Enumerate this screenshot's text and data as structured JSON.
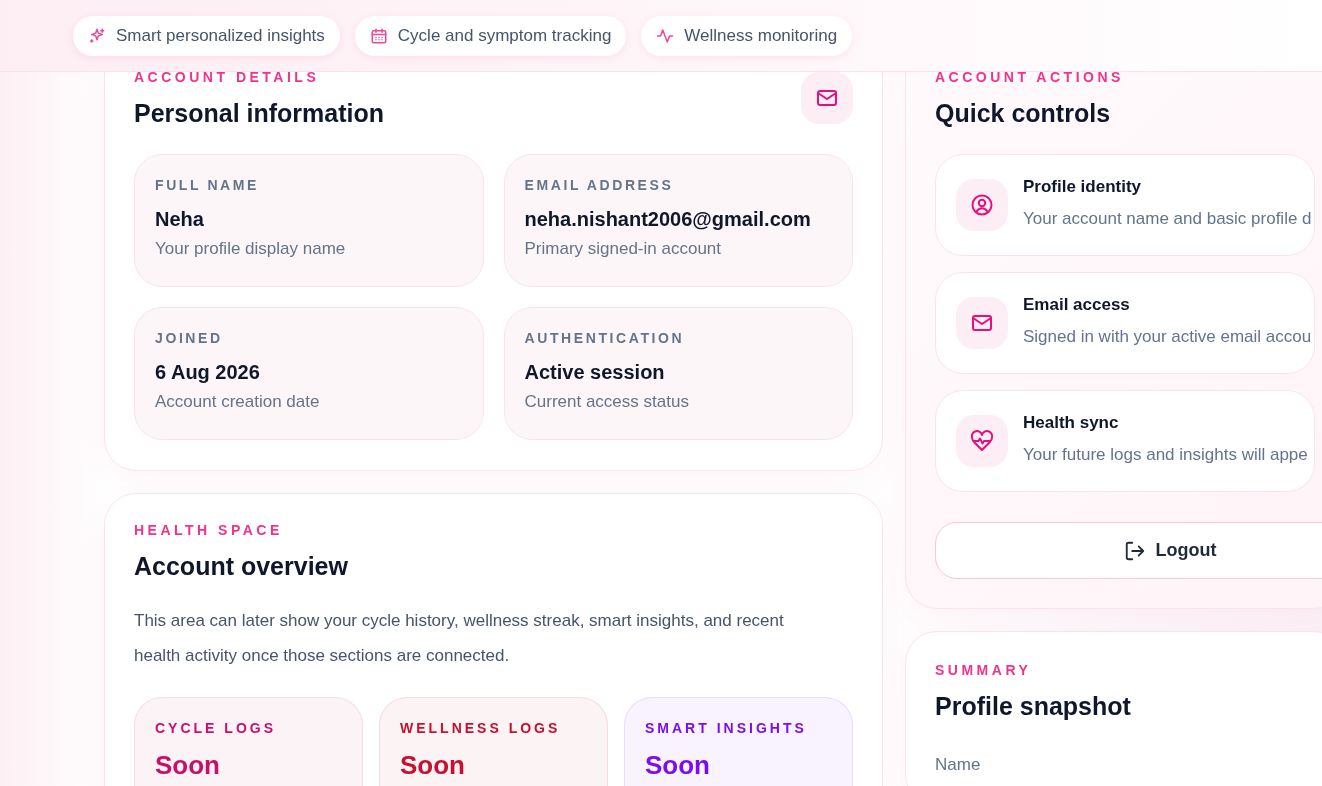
{
  "header": {
    "chips": [
      {
        "kind": "sparkles",
        "label": "Smart personalized insights"
      },
      {
        "kind": "calendar",
        "label": "Cycle and symptom tracking"
      },
      {
        "kind": "activity",
        "label": "Wellness monitoring"
      }
    ]
  },
  "account_details": {
    "eyebrow": "ACCOUNT DETAILS",
    "title": "Personal information",
    "fields": [
      {
        "label": "FULL NAME",
        "value": "Neha",
        "hint": "Your profile display name"
      },
      {
        "label": "EMAIL ADDRESS",
        "value": "neha.nishant2006@gmail.com",
        "hint": "Primary signed-in account"
      },
      {
        "label": "JOINED",
        "value": "6 Aug 2026",
        "hint": "Account creation date"
      },
      {
        "label": "AUTHENTICATION",
        "value": "Active session",
        "hint": "Current access status"
      }
    ]
  },
  "overview": {
    "eyebrow": "HEALTH SPACE",
    "title": "Account overview",
    "text": "This area can later show your cycle history, wellness streak, smart insights, and recent health activity once those sections are connected.",
    "tiles": [
      {
        "label": "CYCLE LOGS",
        "value": "Soon",
        "color": "#c8106a"
      },
      {
        "label": "WELLNESS LOGS",
        "value": "Soon",
        "color": "#c8102e"
      },
      {
        "label": "SMART INSIGHTS",
        "value": "Soon",
        "color": "#7a0ef0"
      }
    ]
  },
  "quick_controls": {
    "eyebrow": "ACCOUNT ACTIONS",
    "title": "Quick controls",
    "items": [
      {
        "kind": "user",
        "title": "Profile identity",
        "description": "Your account name and basic profile d"
      },
      {
        "kind": "mail",
        "title": "Email access",
        "description": "Signed in with your active email accou"
      },
      {
        "kind": "health",
        "title": "Health sync",
        "description": "Your future logs and insights will appe"
      }
    ],
    "logout": {
      "label": "Logout"
    }
  },
  "summary": {
    "eyebrow": "SUMMARY",
    "title": "Profile snapshot",
    "rows": [
      {
        "label": "Name"
      }
    ]
  }
}
